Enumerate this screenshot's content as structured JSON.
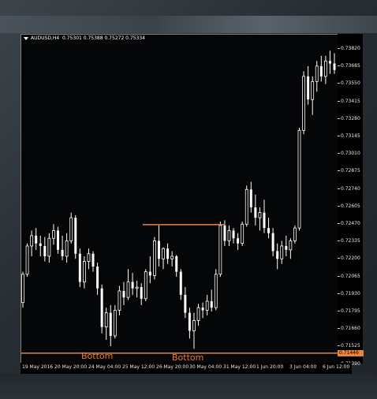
{
  "chart_header": {
    "symbol": "AUDUSD,H4",
    "ohlc": "0.75301 0.75388 0.75272 0.75334"
  },
  "price_axis": [
    "0.73820",
    "0.73685",
    "0.73550",
    "0.73415",
    "0.73280",
    "0.73145",
    "0.73010",
    "0.72875",
    "0.72740",
    "0.72605",
    "0.72470",
    "0.72335",
    "0.72200",
    "0.72065",
    "0.71930",
    "0.71795",
    "0.71660",
    "0.71525",
    "0.71390"
  ],
  "current_price": "0.71446",
  "time_axis": [
    "19 May 2016",
    "20 May 20:00",
    "24 May 04:00",
    "25 May 12:00",
    "26 May 20:00",
    "30 May 04:00",
    "31 May 12:00",
    "1 Jun 20:00",
    "3 Jun 04:00",
    "6 Jun 12:00"
  ],
  "annotations": {
    "bottom_left": "Bottom",
    "bottom_right": "Bottom"
  },
  "colors": {
    "background": "#050608",
    "candle": "#ffffff",
    "line_orange": "#e8843a",
    "label_orange": "#ee7d2f"
  },
  "chart_data": {
    "type": "candlestick",
    "title": "AUDUSD,H4",
    "ylim": [
      0.7139,
      0.7386
    ],
    "support_level": 0.71446,
    "resistance_level": 0.72446,
    "candles": [
      [
        0.7184,
        0.7208,
        0.718,
        0.7206
      ],
      [
        0.7206,
        0.723,
        0.7204,
        0.7228
      ],
      [
        0.7228,
        0.724,
        0.722,
        0.7236
      ],
      [
        0.7236,
        0.7242,
        0.7225,
        0.723
      ],
      [
        0.723,
        0.7236,
        0.722,
        0.7228
      ],
      [
        0.7228,
        0.7235,
        0.7216,
        0.722
      ],
      [
        0.722,
        0.7238,
        0.7215,
        0.7234
      ],
      [
        0.7234,
        0.7245,
        0.7229,
        0.724
      ],
      [
        0.724,
        0.7243,
        0.7222,
        0.7225
      ],
      [
        0.7225,
        0.7236,
        0.7217,
        0.722
      ],
      [
        0.722,
        0.7238,
        0.7215,
        0.7232
      ],
      [
        0.7232,
        0.7254,
        0.723,
        0.725
      ],
      [
        0.725,
        0.7252,
        0.7218,
        0.7222
      ],
      [
        0.7222,
        0.7226,
        0.7196,
        0.72
      ],
      [
        0.72,
        0.722,
        0.7195,
        0.7216
      ],
      [
        0.7216,
        0.7226,
        0.721,
        0.7222
      ],
      [
        0.7222,
        0.7224,
        0.7208,
        0.7212
      ],
      [
        0.7212,
        0.7215,
        0.719,
        0.7195
      ],
      [
        0.7195,
        0.7198,
        0.716,
        0.7165
      ],
      [
        0.7165,
        0.718,
        0.7155,
        0.7176
      ],
      [
        0.7176,
        0.7182,
        0.715,
        0.7158
      ],
      [
        0.7158,
        0.7182,
        0.7156,
        0.7178
      ],
      [
        0.7178,
        0.7197,
        0.7174,
        0.7193
      ],
      [
        0.7193,
        0.72,
        0.7182,
        0.7188
      ],
      [
        0.7188,
        0.721,
        0.7186,
        0.72
      ],
      [
        0.72,
        0.7207,
        0.719,
        0.7195
      ],
      [
        0.7195,
        0.7201,
        0.7188,
        0.7196
      ],
      [
        0.7196,
        0.7199,
        0.7182,
        0.7187
      ],
      [
        0.7187,
        0.721,
        0.7185,
        0.7208
      ],
      [
        0.7208,
        0.722,
        0.7199,
        0.7205
      ],
      [
        0.7205,
        0.7235,
        0.7202,
        0.7232
      ],
      [
        0.7232,
        0.7244,
        0.7212,
        0.7218
      ],
      [
        0.7218,
        0.7227,
        0.721,
        0.7226
      ],
      [
        0.7226,
        0.723,
        0.7214,
        0.7218
      ],
      [
        0.7218,
        0.7224,
        0.7212,
        0.722
      ],
      [
        0.722,
        0.7221,
        0.7204,
        0.7208
      ],
      [
        0.7208,
        0.721,
        0.7186,
        0.719
      ],
      [
        0.719,
        0.7196,
        0.7172,
        0.7176
      ],
      [
        0.7176,
        0.718,
        0.7156,
        0.7162
      ],
      [
        0.7162,
        0.7176,
        0.7148,
        0.717
      ],
      [
        0.717,
        0.7183,
        0.7166,
        0.718
      ],
      [
        0.718,
        0.7184,
        0.7172,
        0.7178
      ],
      [
        0.7178,
        0.719,
        0.7174,
        0.7185
      ],
      [
        0.7185,
        0.7194,
        0.7177,
        0.718
      ],
      [
        0.718,
        0.721,
        0.7178,
        0.7206
      ],
      [
        0.7206,
        0.7247,
        0.7204,
        0.7244
      ],
      [
        0.7244,
        0.7248,
        0.7228,
        0.7232
      ],
      [
        0.7232,
        0.7244,
        0.7228,
        0.724
      ],
      [
        0.724,
        0.7242,
        0.723,
        0.7234
      ],
      [
        0.7234,
        0.7238,
        0.7225,
        0.723
      ],
      [
        0.723,
        0.7247,
        0.7228,
        0.7245
      ],
      [
        0.7245,
        0.7275,
        0.7243,
        0.7272
      ],
      [
        0.7272,
        0.7278,
        0.7254,
        0.7258
      ],
      [
        0.7258,
        0.7268,
        0.7244,
        0.725
      ],
      [
        0.725,
        0.7258,
        0.724,
        0.7254
      ],
      [
        0.7254,
        0.7264,
        0.7238,
        0.7242
      ],
      [
        0.7242,
        0.725,
        0.7234,
        0.7238
      ],
      [
        0.7238,
        0.7242,
        0.722,
        0.7224
      ],
      [
        0.7224,
        0.723,
        0.721,
        0.7218
      ],
      [
        0.7218,
        0.7232,
        0.7214,
        0.7228
      ],
      [
        0.7228,
        0.7236,
        0.722,
        0.7225
      ],
      [
        0.7225,
        0.7234,
        0.7218,
        0.7232
      ],
      [
        0.7232,
        0.7244,
        0.723,
        0.7242
      ],
      [
        0.7242,
        0.732,
        0.724,
        0.7318
      ],
      [
        0.7318,
        0.7364,
        0.7315,
        0.736
      ],
      [
        0.736,
        0.7368,
        0.7338,
        0.7342
      ],
      [
        0.7342,
        0.736,
        0.733,
        0.7356
      ],
      [
        0.7356,
        0.7372,
        0.7348,
        0.7368
      ],
      [
        0.7368,
        0.7376,
        0.7356,
        0.736
      ],
      [
        0.736,
        0.7376,
        0.7354,
        0.7372
      ],
      [
        0.7372,
        0.738,
        0.7362,
        0.737
      ],
      [
        0.737,
        0.7378,
        0.7362,
        0.7365
      ]
    ]
  }
}
